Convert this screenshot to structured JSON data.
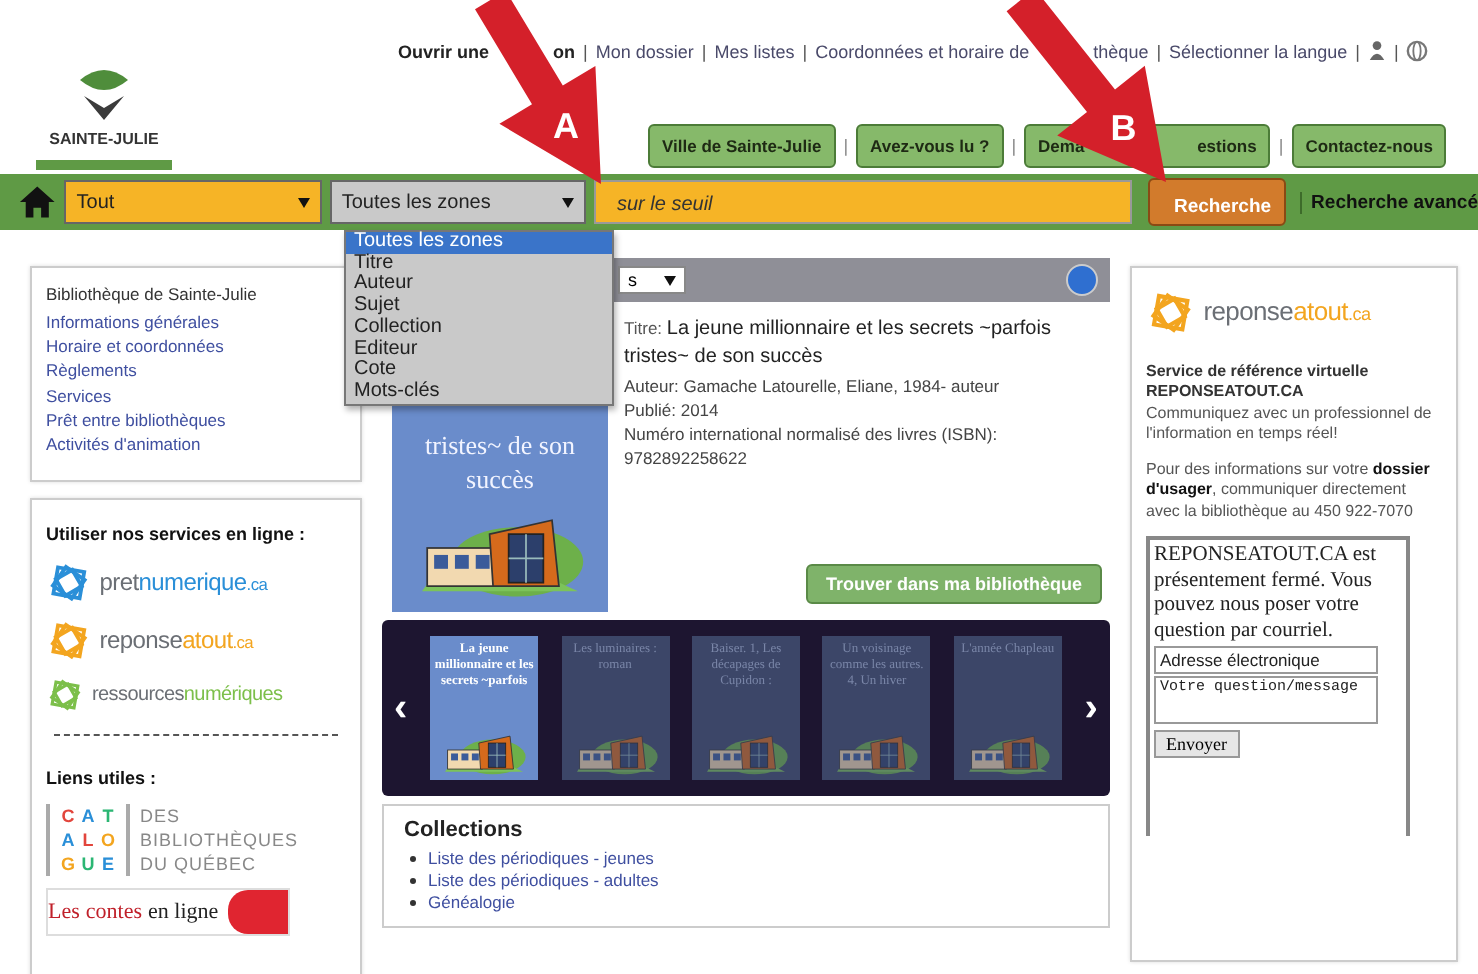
{
  "top_links": [
    {
      "label": "Ouvrir une",
      "tail": "on",
      "bold": true
    },
    {
      "label": "Mon dossier",
      "bold": false
    },
    {
      "label": "Mes listes",
      "bold": false
    },
    {
      "label": "Coordonnées et horaire de",
      "tail": "thèque",
      "bold": false
    },
    {
      "label": "Sélectionner la langue",
      "bold": false
    }
  ],
  "link_separator": "|",
  "logo": {
    "text": "SAINTE-JULIE"
  },
  "nav_tabs": [
    {
      "label": "Ville de Sainte-Julie"
    },
    {
      "label": "Avez-vous lu ?"
    },
    {
      "label": "Dema",
      "tail": "estions"
    },
    {
      "label": "Contactez-nous"
    }
  ],
  "tab_separator": "|",
  "search": {
    "scope": "Tout",
    "zone": "Toutes les zones",
    "query": "sur le seuil",
    "button": "Recherche",
    "advanced": "Recherche avancé"
  },
  "zone_options": [
    {
      "label": "Toutes les zones",
      "selected": true
    },
    {
      "label": "Titre",
      "selected": false
    },
    {
      "label": "Auteur",
      "selected": false
    },
    {
      "label": "Sujet",
      "selected": false
    },
    {
      "label": "Collection",
      "selected": false
    },
    {
      "label": "Editeur",
      "selected": false
    },
    {
      "label": "Cote",
      "selected": false
    },
    {
      "label": "Mots-clés",
      "selected": false
    }
  ],
  "library": {
    "title": "Bibliothèque de Sainte-Julie",
    "links": [
      "Informations générales",
      "Horaire et coordonnées",
      "Règlements",
      "Services",
      "Prêt entre bibliothèques",
      "Activités d'animation"
    ]
  },
  "services": {
    "heading": "Utiliser nos services en ligne :",
    "logos": [
      {
        "parts": [
          "pret",
          "numerique",
          ".ca"
        ]
      },
      {
        "parts": [
          "reponse",
          "atout",
          ".ca"
        ]
      },
      {
        "parts": [
          "ressources",
          "numériques"
        ]
      }
    ],
    "links_heading": "Liens utiles :",
    "catalogue": {
      "letters": [
        "C",
        "A",
        "T",
        "A",
        "L",
        "O",
        "G",
        "U",
        "E"
      ],
      "lines": [
        "DES",
        "BIBLIOTHÈQUES",
        "DU QUÉBEC"
      ]
    },
    "contes": {
      "parts": [
        "Les",
        "contes",
        "en ligne"
      ]
    }
  },
  "result": {
    "sort": "s",
    "cover_title": "tristes~ de son succès",
    "title_label": "Titre:",
    "title": "La jeune millionnaire et les secrets ~parfois tristes~ de son succès",
    "lines": [
      "Auteur: Gamache Latourelle, Eliane, 1984- auteur",
      "Publié: 2014",
      "Numéro international normalisé des livres (ISBN):",
      "9782892258622"
    ],
    "find_button": "Trouver dans ma bibliothèque"
  },
  "carousel_prev": "‹",
  "carousel_next": "›",
  "carousel": [
    {
      "title": "La jeune millionnaire et les secrets ~parfois",
      "selected": true
    },
    {
      "title": "Les luminaires : roman",
      "selected": false
    },
    {
      "title": "Baiser. 1, Les décapages de Cupidon :",
      "selected": false
    },
    {
      "title": "Un voisinage comme les autres. 4, Un hiver",
      "selected": false
    },
    {
      "title": "L'année Chapleau",
      "selected": false
    }
  ],
  "collections": {
    "heading": "Collections",
    "items": [
      "Liste des périodiques - jeunes",
      "Liste des périodiques - adultes",
      "Généalogie"
    ]
  },
  "reference": {
    "logo": {
      "parts": [
        "reponse",
        "atout",
        ".ca"
      ]
    },
    "heading": "Service de référence virtuelle",
    "name": "REPONSEATOUT.CA",
    "intro": "Communiquez avec un professionnel de l'information en temps réel!",
    "info": "Pour des informations sur votre **dossier d'usager**, communiquer directement avec la bibliothèque au 450 922-7070",
    "closed_message": "REPONSEATOUT.CA est présentement fermé. Vous pouvez nous poser votre question par courriel.",
    "email_placeholder": "Adresse électronique",
    "message_placeholder": "Votre question/message",
    "send_button": "Envoyer"
  },
  "annotations": [
    {
      "letter": "A"
    },
    {
      "letter": "B"
    }
  ]
}
